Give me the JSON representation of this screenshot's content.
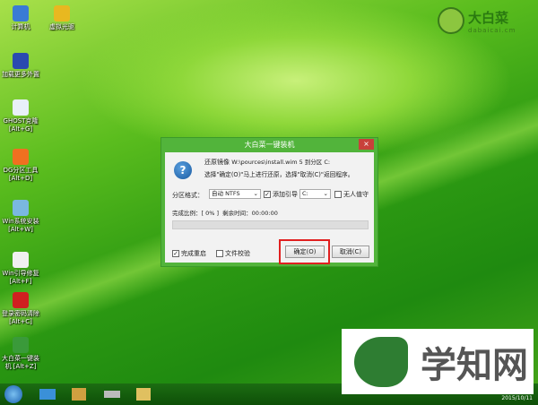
{
  "desktop_icons": [
    {
      "label": "计算机",
      "color": "#3a7bd5"
    },
    {
      "label": "虚拟光驱",
      "color": "#e8b820"
    },
    {
      "label": "加载更多外置",
      "color": "#2a4ab0"
    },
    {
      "label": "GHOST克隆",
      "sub": "[Alt+G]",
      "color": "#e8f0f8"
    },
    {
      "label": "DG分区工具",
      "sub": "[Alt+D]",
      "color": "#f07020"
    },
    {
      "label": "Win系统安装",
      "sub": "[Alt+W]",
      "color": "#7ab8e0"
    },
    {
      "label": "Win引导修复",
      "sub": "[Alt+F]",
      "color": "#f0f0f0"
    },
    {
      "label": "登录密码清除",
      "sub": "[Alt+C]",
      "color": "#d02020"
    },
    {
      "label": "大白菜一键装",
      "sub": "机 [Alt+Z]",
      "color": "#3a9a3a"
    }
  ],
  "logo": {
    "name": "大白菜",
    "url_text": "dabaicai.cm"
  },
  "dialog": {
    "title": "大白菜一键装机",
    "close": "×",
    "line1_label": "还原镜像",
    "line1_value": "W:\\pources\\install.wim 5 到分区 C:",
    "line2": "选择\"确定(O)\"马上进行还原，选择\"取消(C)\"返回程序。",
    "partition_format_label": "分区格式：",
    "partition_format_value": "自动 NTFS",
    "add_boot_label": "添加引导",
    "add_boot_checked": true,
    "drive_value": "C:",
    "unattended_label": "无人值守",
    "unattended_checked": false,
    "progress_label": "完成比例：",
    "progress_text": "[ 0% ]",
    "progress": 0,
    "remaining_label": "剩余时间：",
    "remaining_value": "00:00:00",
    "reboot_label": "完成重启",
    "reboot_checked": true,
    "verify_label": "文件校验",
    "verify_checked": false,
    "ok_label": "确定(O)",
    "cancel_label": "取消(C)"
  },
  "watermark": {
    "text": "学知网"
  },
  "clock": "2015/10/11"
}
